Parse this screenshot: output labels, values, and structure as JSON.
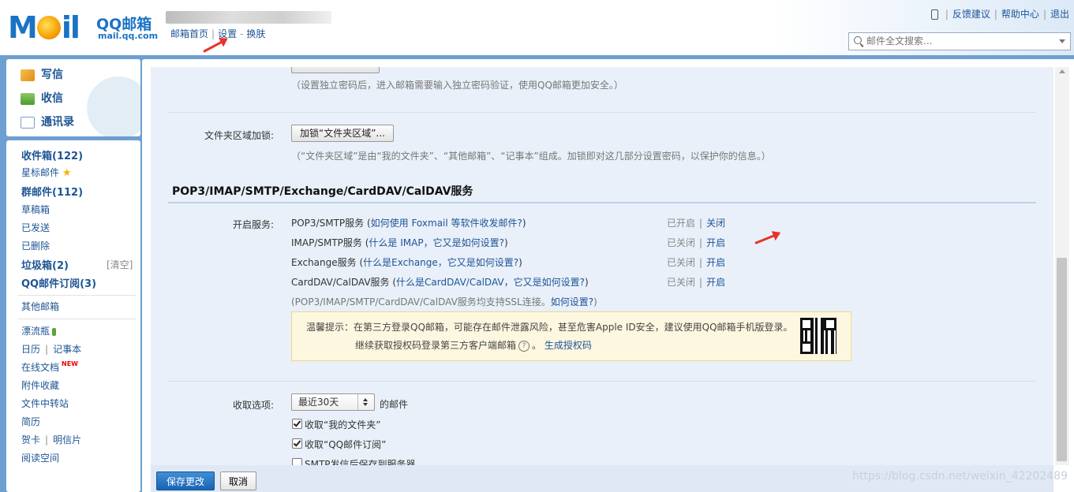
{
  "header": {
    "logo_text": "M  il",
    "logo_brand": "QQ邮箱",
    "logo_domain": "mail.qq.com",
    "nav": [
      "邮箱首页",
      "设置",
      "换肤"
    ],
    "nav_sep1": "|",
    "nav_sep2": "-",
    "links": [
      "反馈建议",
      "帮助中心",
      "退出"
    ],
    "search_placeholder": "邮件全文搜索..."
  },
  "sidebar": {
    "actions": [
      {
        "label": "写信",
        "icon": "compose-icon"
      },
      {
        "label": "收信",
        "icon": "inbox-download-icon"
      },
      {
        "label": "通讯录",
        "icon": "contacts-icon"
      }
    ],
    "folders": {
      "inbox": "收件箱(122)",
      "starred": "星标邮件",
      "group": "群邮件(112)",
      "drafts": "草稿箱",
      "sent": "已发送",
      "deleted": "已删除",
      "spam": "垃圾箱(2)",
      "spam_clear": "[清空]",
      "subscribe": "QQ邮件订阅(3)",
      "other": "其他邮箱",
      "bottle": "漂流瓶",
      "calendar": "日历",
      "notes": "记事本",
      "docs": "在线文档",
      "new_badge": "NEW",
      "attach": "附件收藏",
      "transfer": "文件中转站",
      "resume": "简历",
      "card": "贺卡",
      "postcard": "明信片",
      "reading": "阅读空间"
    }
  },
  "content": {
    "pw_hint": "（设置独立密码后，进入邮箱需要输入独立密码验证，使用QQ邮箱更加安全。）",
    "folder_lock_label": "文件夹区域加锁:",
    "folder_lock_button": "加锁“文件夹区域”...",
    "folder_lock_hint": "（“文件夹区域”是由“我的文件夹”、“其他邮箱”、“记事本”组成。加锁即对这几部分设置密码，以保护你的信息。）",
    "section_title": "POP3/IMAP/SMTP/Exchange/CardDAV/CalDAV服务",
    "services_label": "开启服务:",
    "services": [
      {
        "name": "POP3/SMTP服务",
        "help": "如何使用 Foxmail 等软件收发邮件?",
        "status": "已开启",
        "action": "关闭"
      },
      {
        "name": "IMAP/SMTP服务",
        "help": "什么是 IMAP，它又是如何设置?",
        "status": "已关闭",
        "action": "开启"
      },
      {
        "name": "Exchange服务",
        "help": "什么是Exchange，它又是如何设置?",
        "status": "已关闭",
        "action": "开启"
      },
      {
        "name": "CardDAV/CalDAV服务",
        "help": "什么是CardDAV/CalDAV，它又是如何设置?",
        "status": "已关闭",
        "action": "开启"
      }
    ],
    "ssl_note": "(POP3/IMAP/SMTP/CardDAV/CalDAV服务均支持SSL连接。",
    "ssl_link": "如何设置?",
    "warning_line1": "温馨提示：在第三方登录QQ邮箱，可能存在邮件泄露风险，甚至危害Apple ID安全，建议使用QQ邮箱手机版登录。",
    "warning_line2": "继续获取授权码登录第三方客户端邮箱",
    "warning_link": "生成授权码",
    "fetch_label": "收取选项:",
    "fetch_select": "最近30天",
    "fetch_suffix": "的邮件",
    "checkboxes": [
      {
        "label": "收取“我的文件夹”",
        "checked": true
      },
      {
        "label": "收取“QQ邮件订阅”",
        "checked": true
      },
      {
        "label": "SMTP发信后保存到服务器",
        "checked": false
      }
    ]
  },
  "footer": {
    "save": "保存更改",
    "cancel": "取消"
  },
  "watermark": "https://blog.csdn.net/weixin_42202489",
  "colors": {
    "accent": "#1e5494",
    "frame": "#6d9fd1",
    "annotation_arrow": "#e8332a"
  }
}
